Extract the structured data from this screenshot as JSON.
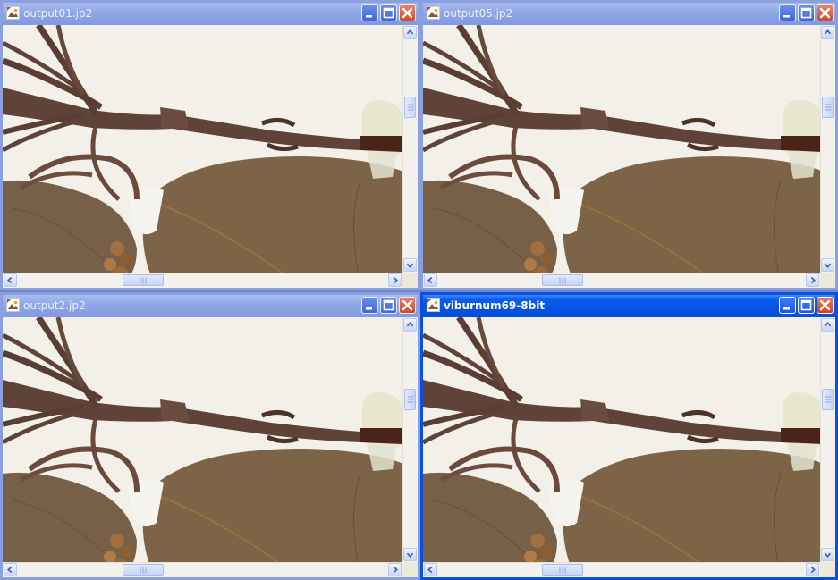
{
  "windows": [
    {
      "id": "win1",
      "title": "output01.jp2",
      "active": false
    },
    {
      "id": "win2",
      "title": "output05.jp2",
      "active": false
    },
    {
      "id": "win3",
      "title": "output2.jp2",
      "active": false
    },
    {
      "id": "win4",
      "title": "viburnum69-8bit",
      "active": true
    }
  ],
  "icons": {
    "app": "image-file-icon",
    "minimize": "minimize-icon",
    "maximize": "maximize-icon",
    "close": "close-icon",
    "scroll_up": "arrow-up-icon",
    "scroll_down": "arrow-down-icon",
    "scroll_left": "arrow-left-icon",
    "scroll_right": "arrow-right-icon"
  },
  "colors": {
    "active_title": "#0453e2",
    "inactive_title": "#8fa6e6",
    "close_button": "#d2401c",
    "paper": "#f1ede6",
    "leaf": "#7e6447",
    "stem": "#5a3e33"
  }
}
